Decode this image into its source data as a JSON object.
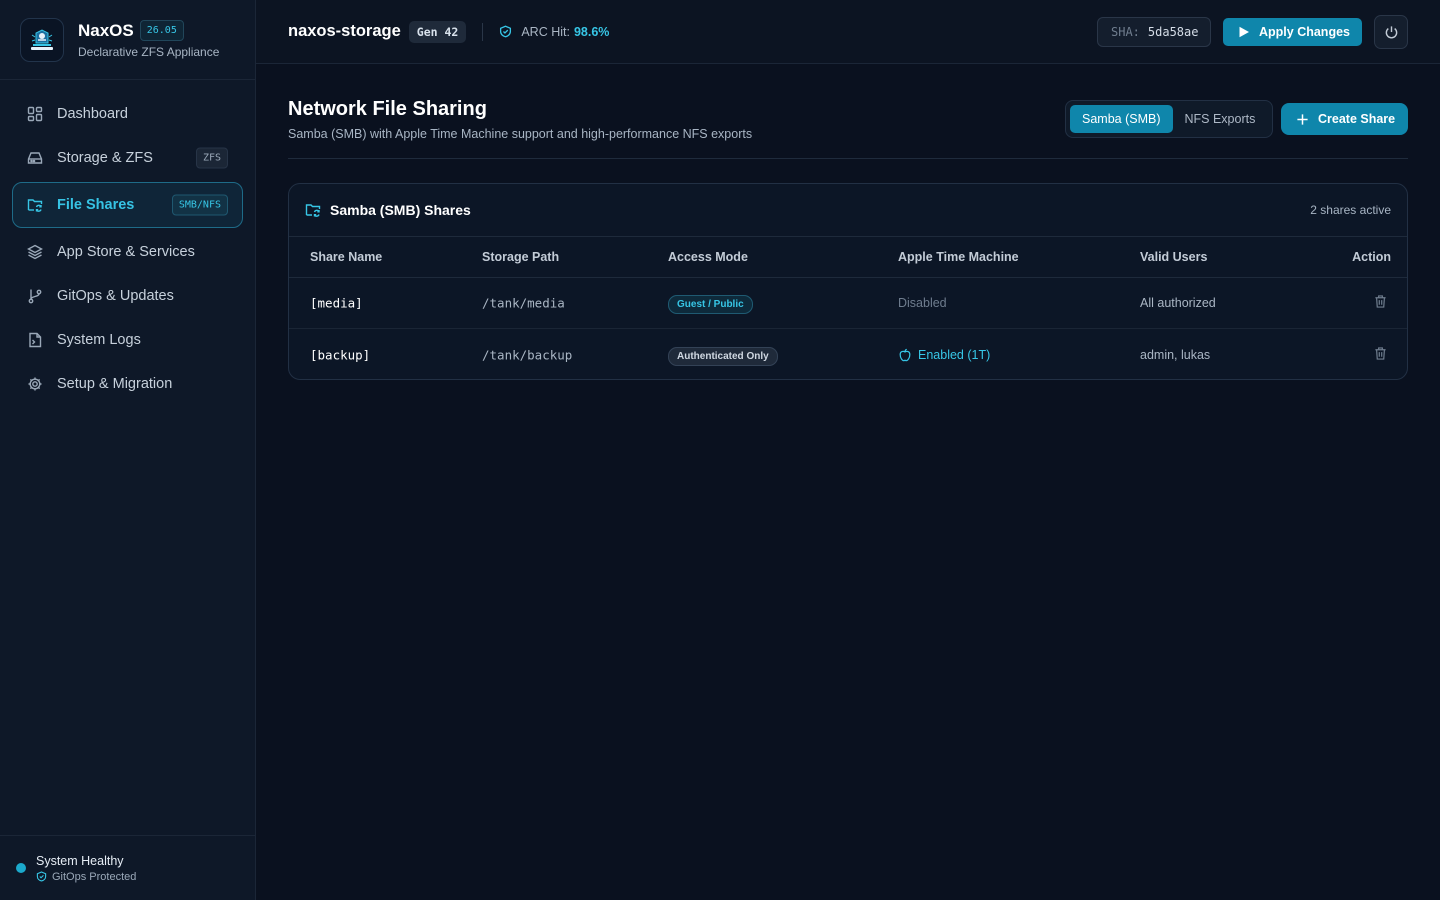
{
  "brand": {
    "name": "NaxOS",
    "version": "26.05",
    "subtitle": "Declarative ZFS Appliance"
  },
  "sidebar": {
    "items": [
      {
        "label": "Dashboard",
        "icon": "grid-icon"
      },
      {
        "label": "Storage & ZFS",
        "icon": "drive-icon",
        "badge": "ZFS"
      },
      {
        "label": "File Shares",
        "icon": "folder-sync-icon",
        "badge": "SMB/NFS",
        "active": true
      },
      {
        "label": "App Store & Services",
        "icon": "layers-icon"
      },
      {
        "label": "GitOps & Updates",
        "icon": "git-branch-icon"
      },
      {
        "label": "System Logs",
        "icon": "file-terminal-icon"
      },
      {
        "label": "Setup & Migration",
        "icon": "gear-icon"
      }
    ],
    "footer": {
      "status": "System Healthy",
      "sub": "GitOps Protected"
    }
  },
  "header": {
    "hostname": "naxos-storage",
    "generation": "Gen 42",
    "arc_label": "ARC Hit:",
    "arc_value": "98.6%",
    "sha_label": "SHA:",
    "sha_value": "5da58ae",
    "apply_label": "Apply Changes"
  },
  "page": {
    "title": "Network File Sharing",
    "subtitle": "Samba (SMB) with Apple Time Machine support and high-performance NFS exports",
    "tabs": [
      {
        "label": "Samba (SMB)",
        "active": true
      },
      {
        "label": "NFS Exports",
        "active": false
      }
    ],
    "create_label": "Create Share"
  },
  "shares_card": {
    "title": "Samba (SMB) Shares",
    "count": "2 shares active",
    "columns": [
      "Share Name",
      "Storage Path",
      "Access Mode",
      "Apple Time Machine",
      "Valid Users",
      "Action"
    ],
    "rows": [
      {
        "name": "[media]",
        "path": "/tank/media",
        "access": "Guest / Public",
        "access_kind": "public",
        "time_machine": "Disabled",
        "tm_enabled": false,
        "users": "All authorized"
      },
      {
        "name": "[backup]",
        "path": "/tank/backup",
        "access": "Authenticated Only",
        "access_kind": "auth",
        "time_machine": "Enabled (1T)",
        "tm_enabled": true,
        "users": "admin, lukas"
      }
    ]
  },
  "colors": {
    "accent": "#0f86ab",
    "accent_text": "#37c6e6",
    "background": "#0a111f",
    "sidebar": "#0e1828"
  }
}
